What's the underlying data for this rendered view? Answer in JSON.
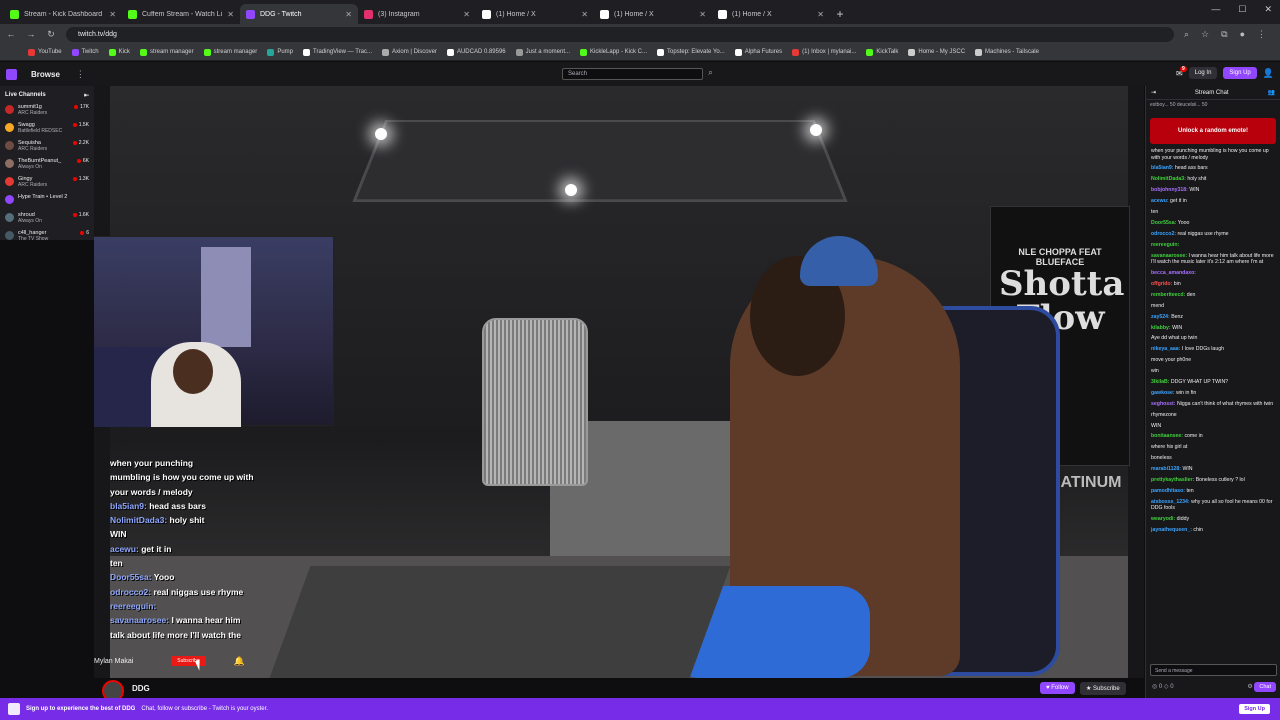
{
  "browser": {
    "tabs": [
      {
        "title": "Stream - Kick Dashboard",
        "color": "#53fc18"
      },
      {
        "title": "Cuffem Stream - Watch Live on",
        "color": "#53fc18"
      },
      {
        "title": "DDG - Twitch",
        "color": "#9146ff",
        "active": true
      },
      {
        "title": "(3) Instagram",
        "color": "#e1306c"
      },
      {
        "title": "(1) Home / X",
        "color": "#ffffff"
      },
      {
        "title": "(1) Home / X",
        "color": "#ffffff"
      },
      {
        "title": "(1) Home / X",
        "color": "#ffffff"
      }
    ],
    "url": "twitch.tv/ddg",
    "bookmarks": [
      "YouTube",
      "Twitch",
      "Kick",
      "stream manager",
      "stream manager",
      "Pump",
      "TradingView — Trac...",
      "Axiom | Discover",
      "AUDCAD 0.89596",
      "Just a moment...",
      "KickleLapp - Kick C...",
      "Topstep: Elevate Yo...",
      "Alpha Futures",
      "(1) Inbox | mylanai...",
      "KickTalk",
      "Home - My JSCC",
      "Machines - Tailscale"
    ]
  },
  "twitch_nav": {
    "browse": "Browse",
    "search_placeholder": "Search",
    "notif_count": "9",
    "login": "Log In",
    "signup": "Sign Up"
  },
  "sidebar": {
    "title": "Live Channels",
    "channels": [
      {
        "name": "summit1g",
        "game": "ARC Raiders",
        "viewers": "17K",
        "color": "#c62828"
      },
      {
        "name": "Swagg",
        "game": "Battlefield REDSEC",
        "viewers": "1.5K",
        "color": "#f9a825"
      },
      {
        "name": "Sequisha",
        "game": "ARC Raiders",
        "viewers": "2.2K",
        "color": "#6d4c41"
      },
      {
        "name": "TheBurntPeanut_",
        "game": "Always On",
        "viewers": "6K",
        "color": "#8d6e63"
      },
      {
        "name": "Gingy",
        "game": "ARC Raiders",
        "viewers": "1.3K",
        "color": "#e53935"
      },
      {
        "name": "Hype Train • Level 2",
        "game": "",
        "viewers": "",
        "color": "#9146ff"
      },
      {
        "name": "shroud",
        "game": "Always On",
        "viewers": "1.6K",
        "color": "#546e7a"
      },
      {
        "name": "c4ll_hanger",
        "game": "The TV Show",
        "viewers": "6",
        "color": "#455a64"
      }
    ]
  },
  "video": {
    "poster_title": "Shotta Flow",
    "poster_top": "NLE CHOPPA FEAT BLUEFACE",
    "platinum": "D PLATINUM",
    "overlay_chat": [
      {
        "user": "",
        "text": "when your punching"
      },
      {
        "user": "",
        "text": "mumbling is how you come up with"
      },
      {
        "user": "",
        "text": "your words / melody"
      },
      {
        "user": "bla5ian9:",
        "text": "head ass bars"
      },
      {
        "user": "NolimitDada3:",
        "text": "holy shit"
      },
      {
        "user": "",
        "text": "WIN"
      },
      {
        "user": "acewu:",
        "text": "get it in"
      },
      {
        "user": "",
        "text": "ten"
      },
      {
        "user": "Door55sa:",
        "text": "Yooo"
      },
      {
        "user": "odrocco2:",
        "text": "real niggas use rhyme"
      },
      {
        "user": "reereeguin:",
        "text": ""
      },
      {
        "user": "savanaarosee:",
        "text": "I wanna hear him"
      },
      {
        "user": "",
        "text": "talk about life more I'll watch the"
      }
    ],
    "streamer_name": "Mylan Makai",
    "streamer_sub": "Subscribe"
  },
  "infobar": {
    "channel": "DDG",
    "follow": "Follow",
    "subscribe": "Subscribe"
  },
  "chat": {
    "header": "Stream Chat",
    "pinned": "estboy... 50   deucelsii... 50",
    "unlock": "Unlock a random emote!",
    "messages": [
      {
        "user": "",
        "text": "when your punching mumbling is how you come up with your words / melody",
        "color": "#ff4f4f"
      },
      {
        "user": "bla5ian9:",
        "text": "head ass bars",
        "color": "#3aa4ff"
      },
      {
        "user": "NolimitDada3:",
        "text": "holy shit",
        "color": "#3fd13a"
      },
      {
        "user": "bobjohnny318:",
        "text": "WIN",
        "color": "#a970ff"
      },
      {
        "user": "acewu:",
        "text": "get it in",
        "color": "#3aa4ff"
      },
      {
        "user": "",
        "text": "ten",
        "color": "#ff4f4f"
      },
      {
        "user": "Door55sa:",
        "text": "Yooo",
        "color": "#3fd13a"
      },
      {
        "user": "odrocco2:",
        "text": "real niggas use rhyme",
        "color": "#3aa4ff"
      },
      {
        "user": "reereeguin:",
        "text": "",
        "color": "#3fd13a"
      },
      {
        "user": "savanaarosee:",
        "text": "I wanna hear him talk about life more I'll watch the music later it's 2:12 am where I'm at",
        "color": "#3fd13a"
      },
      {
        "user": "becca_amandaxo:",
        "text": "",
        "color": "#a970ff"
      },
      {
        "user": "offgrido:",
        "text": "bin",
        "color": "#ff4f4f"
      },
      {
        "user": "remberiteecd:",
        "text": "den",
        "color": "#3fd13a"
      },
      {
        "user": "",
        "text": "mend",
        "color": "#ff4f4f"
      },
      {
        "user": "zay524:",
        "text": "Benz",
        "color": "#3aa4ff"
      },
      {
        "user": "",
        "text": "",
        "color": "#ff4f4f"
      },
      {
        "user": "kilabby:",
        "text": "WIN",
        "color": "#3fd13a"
      },
      {
        "user": "",
        "text": "Aye dd what up twin",
        "color": "#ff4f4f"
      },
      {
        "user": "nikeya_aaa:",
        "text": "I love DDGs laugh",
        "color": "#3aa4ff"
      },
      {
        "user": "",
        "text": "move your ph0ne",
        "color": "#ff4f4f"
      },
      {
        "user": "",
        "text": "win",
        "color": "#ff4f4f"
      },
      {
        "user": "3lkilaB:",
        "text": "DDGY WHAT UP TWIN?",
        "color": "#3fd13a"
      },
      {
        "user": "gawkose:",
        "text": "win in fin",
        "color": "#3aa4ff"
      },
      {
        "user": "seghosst:",
        "text": "Nigga can't think of what rhymes with twin",
        "color": "#a970ff"
      },
      {
        "user": "",
        "text": "rhymezone",
        "color": "#3aa4ff"
      },
      {
        "user": "",
        "text": "WIN",
        "color": "#ff4f4f"
      },
      {
        "user": "bonitaansee:",
        "text": "come in",
        "color": "#3fd13a"
      },
      {
        "user": "",
        "text": "where his girl at",
        "color": "#3aa4ff"
      },
      {
        "user": "",
        "text": "boneless",
        "color": "#3fd13a"
      },
      {
        "user": "marabi1128:",
        "text": "WIN",
        "color": "#3aa4ff"
      },
      {
        "user": "prettykaythaslier:",
        "text": "Boneless cutlery ? lol",
        "color": "#3fd13a"
      },
      {
        "user": "pamodhitaso:",
        "text": "ten",
        "color": "#3aa4ff"
      },
      {
        "user": "atsbosss_1234:",
        "text": "why you all so fool he means 00 for DDG fools",
        "color": "#3aa4ff"
      },
      {
        "user": "wearyodi:",
        "text": "diddy",
        "color": "#3fd13a"
      },
      {
        "user": "jaynathequeen_:",
        "text": "chin",
        "color": "#3aa4ff"
      }
    ],
    "input_placeholder": "Send a message",
    "points": "0",
    "bits": "0",
    "chat_button": "Chat"
  },
  "banner": {
    "headline": "Sign up to experience the best of DDG",
    "sub": "Chat, follow or subscribe - Twitch is your oyster.",
    "signup": "Sign Up"
  }
}
